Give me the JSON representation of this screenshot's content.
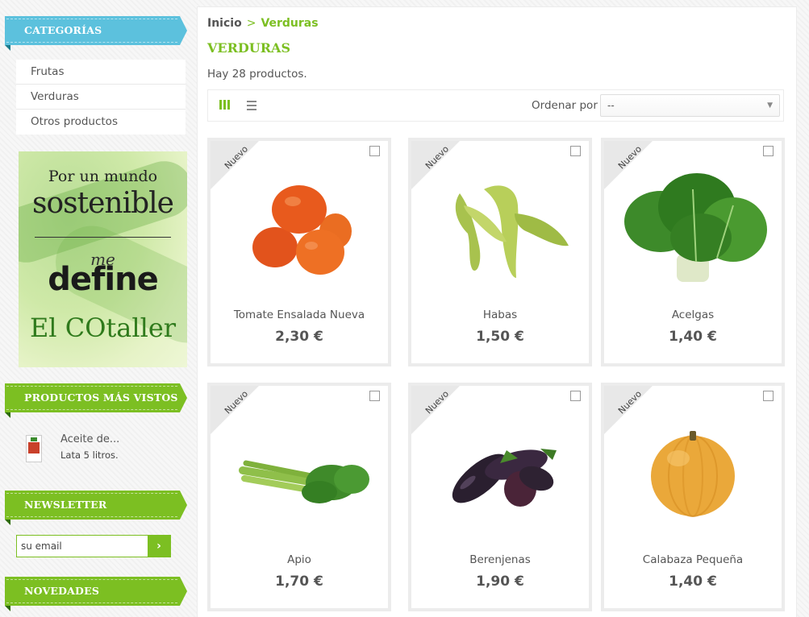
{
  "sidebar": {
    "categories_title": "CATEGORÍAS",
    "categories": [
      "Frutas",
      "Verduras",
      "Otros productos"
    ],
    "promo": {
      "line1": "Por un mundo",
      "line2": "sostenible",
      "line3": "me",
      "line4": "define",
      "line5": "El COtaller"
    },
    "most_viewed_title": "PRODUCTOS MÁS VISTOS",
    "most_viewed_item": {
      "name": "Aceite de...",
      "desc": "Lata 5 litros."
    },
    "newsletter_title": "NEWSLETTER",
    "newsletter_placeholder": "su email",
    "newsletter_button": "›",
    "news_title": "NOVEDADES"
  },
  "breadcrumb": {
    "home": "Inicio",
    "separator": ">",
    "current": "Verduras"
  },
  "page_title": "VERDURAS",
  "product_count": "Hay 28 productos.",
  "toolbar": {
    "sort_label": "Ordenar por",
    "sort_value": "--",
    "sort_caret": "▼"
  },
  "products": [
    {
      "badge": "Nuevo",
      "name": "Tomate Ensalada Nueva",
      "price": "2,30 €",
      "icon": "tomato-image"
    },
    {
      "badge": "Nuevo",
      "name": "Habas",
      "price": "1,50 €",
      "icon": "broad-beans-image"
    },
    {
      "badge": "Nuevo",
      "name": "Acelgas",
      "price": "1,40 €",
      "icon": "chard-image"
    },
    {
      "badge": "Nuevo",
      "name": "Apio",
      "price": "1,70 €",
      "icon": "celery-image"
    },
    {
      "badge": "Nuevo",
      "name": "Berenjenas",
      "price": "1,90 €",
      "icon": "eggplant-image"
    },
    {
      "badge": "Nuevo",
      "name": "Calabaza Pequeña",
      "price": "1,40 €",
      "icon": "pumpkin-image"
    }
  ],
  "colors": {
    "accent_green": "#7cbf22",
    "ribbon_blue": "#5cc1dd"
  }
}
